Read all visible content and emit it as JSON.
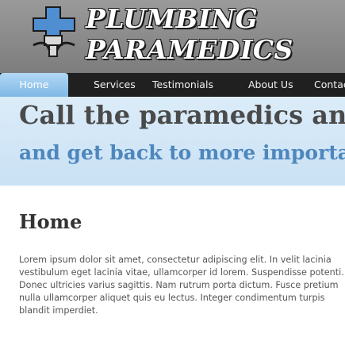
{
  "header": {
    "logo_line1": "PLUMBING",
    "logo_line2": "PARAMEDICS",
    "logo_icon": "plumbing-cross-icon",
    "colors": {
      "logo_blue": "#4f8ed0",
      "logo_grey": "#d9d9d9"
    }
  },
  "nav": {
    "items": [
      {
        "label": "Home",
        "active": true
      },
      {
        "label": "Services"
      },
      {
        "label": "Testimonials"
      },
      {
        "label": "About Us"
      },
      {
        "label": "Contact"
      }
    ],
    "colors": {
      "bar": "#202020",
      "active": "#93c6ee"
    }
  },
  "banner": {
    "line1": "Call the paramedics and",
    "line2": "and get back to more important things"
  },
  "content": {
    "title": "Home",
    "lines": [
      "Lorem ipsum dolor sit amet, consectetur adipiscing elit. In velit lacinia",
      "vestibulum eget lacinia vitae, ullamcorper id lorem. Suspendisse potenti.",
      "Donec ultricies varius sagittis. Nam rutrum porta dictum. Fusce pretium",
      "nulla ullamcorper aliquet quis eu lectus. Integer condimentum turpis",
      "blandit imperdiet."
    ]
  }
}
